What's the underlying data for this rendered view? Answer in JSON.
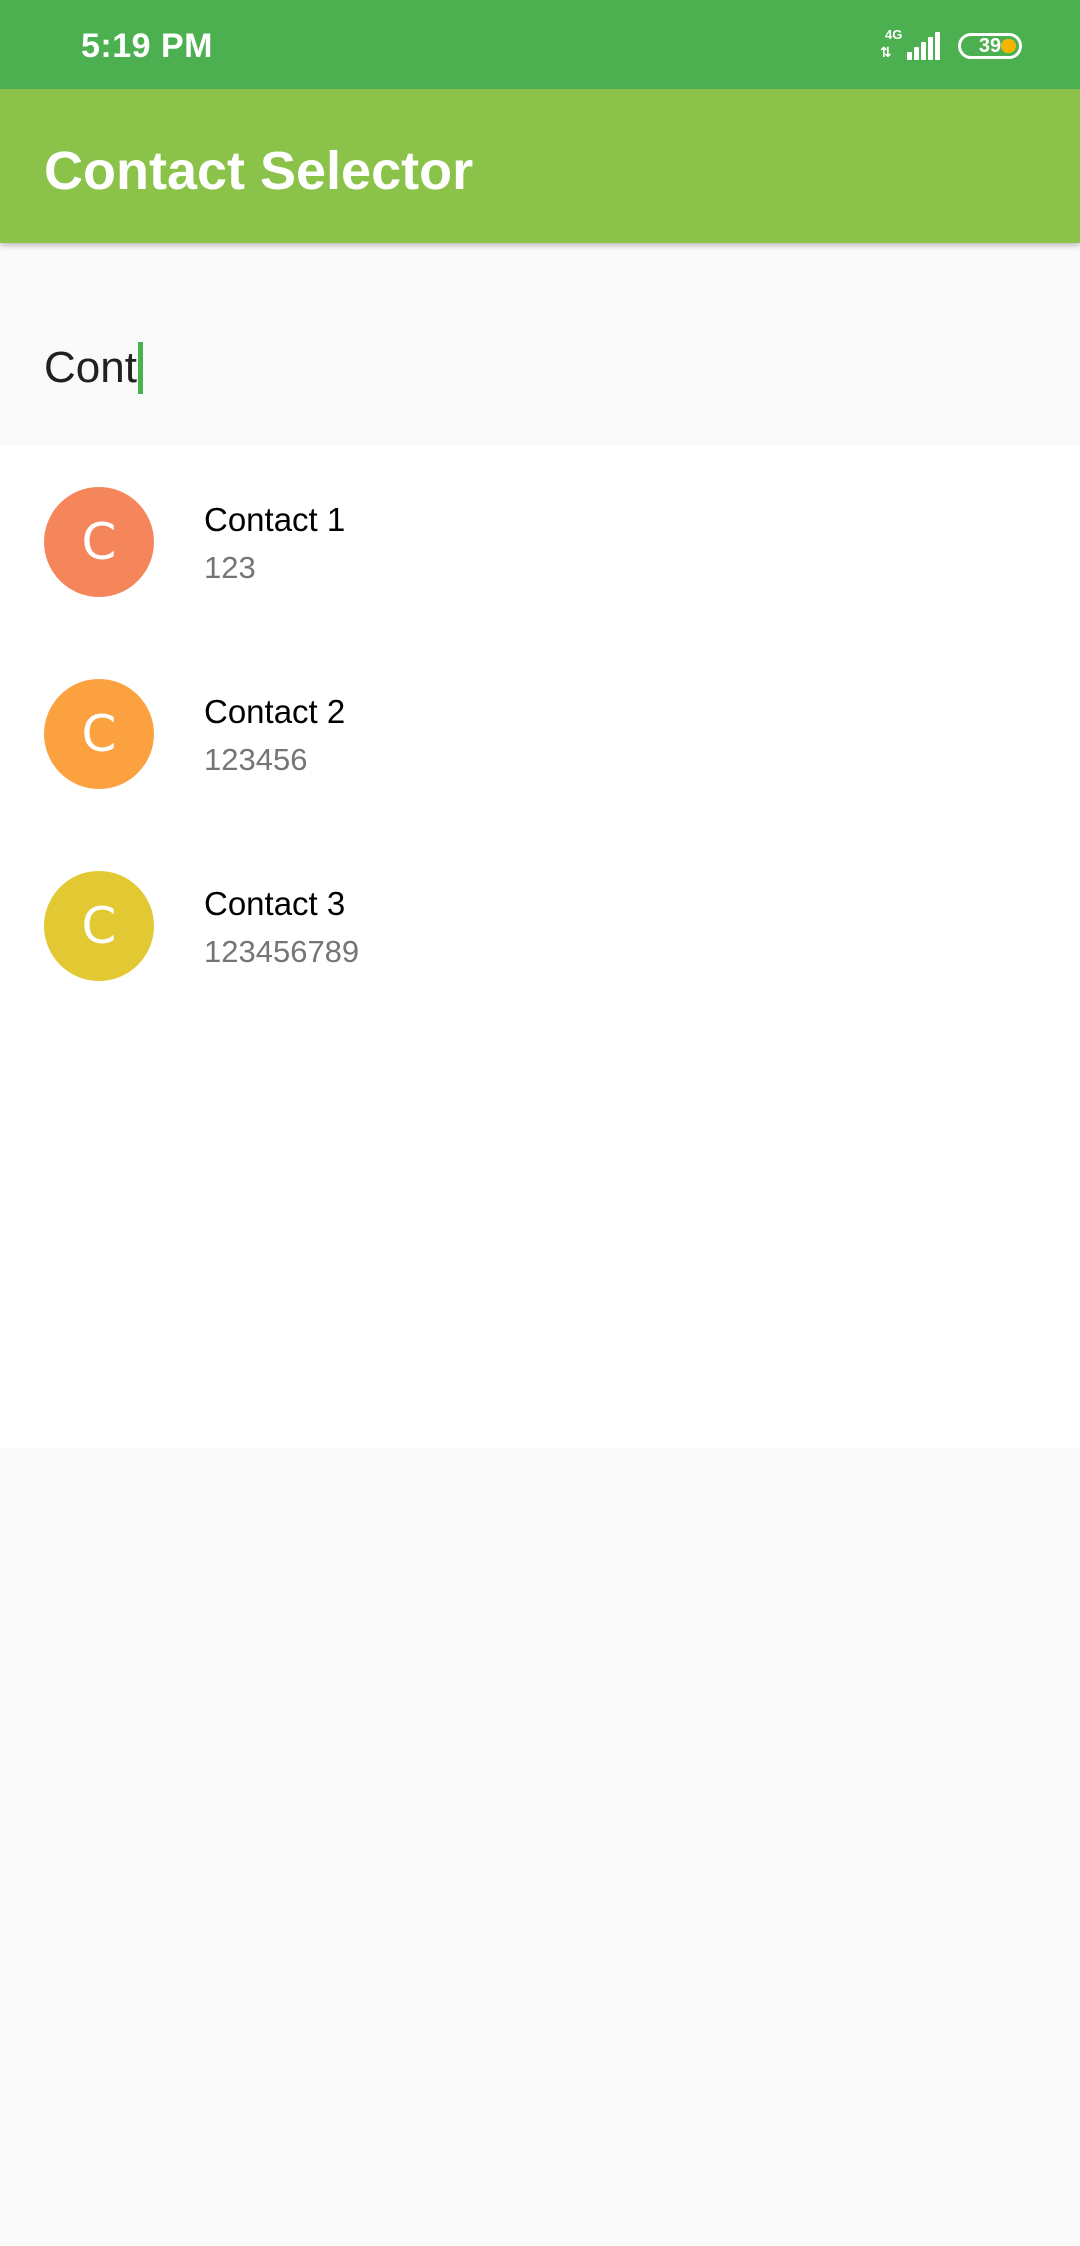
{
  "status_bar": {
    "time": "5:19 PM",
    "network_type": "4G",
    "network_arrows": "⇅",
    "battery_level": "39",
    "icons": [
      "network-4g-icon",
      "signal-icon",
      "battery-icon"
    ]
  },
  "app_bar": {
    "title": "Contact Selector",
    "color": "#8bc34a"
  },
  "search": {
    "value": "Cont",
    "cursor_color": "#4caf50"
  },
  "contacts": [
    {
      "initial": "C",
      "name": "Contact 1",
      "number": "123",
      "avatar_color": "#f5865c"
    },
    {
      "initial": "C",
      "name": "Contact 2",
      "number": "123456",
      "avatar_color": "#fba140"
    },
    {
      "initial": "C",
      "name": "Contact 3",
      "number": "123456789",
      "avatar_color": "#e2c833"
    }
  ],
  "colors": {
    "status_bar": "#4caf50",
    "app_bar": "#8bc34a",
    "background": "#fafafa",
    "list_background": "#ffffff",
    "secondary_text": "#757575"
  }
}
